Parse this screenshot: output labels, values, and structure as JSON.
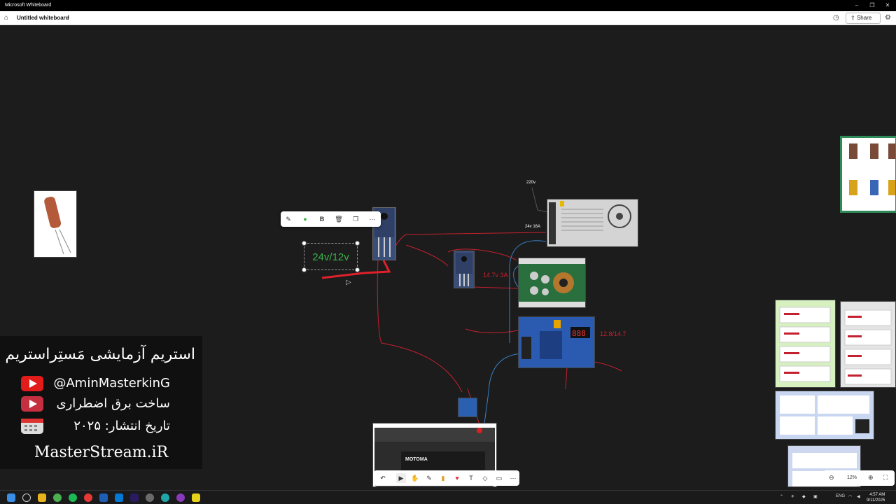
{
  "window": {
    "title": "Microsoft Whiteboard"
  },
  "appbar": {
    "board_name": "Untitled whiteboard",
    "share_label": "Share"
  },
  "canvas_labels": {
    "selected_text": "24v/12v",
    "label_220": "220v",
    "label_24v16a": "24v 16A",
    "label_147": "14.7v 3A",
    "label_128": "12.8/14.7",
    "battery_brand": "MOTOMA"
  },
  "overlay": {
    "headline": "استریم آزمایشی مَستِراستریم",
    "youtube": "@AminMasterkinG",
    "topic": "ساخت برق اضطراری",
    "date": "تاریخ انتشار: ۲۰۲۵",
    "site": "MasterStream.iR"
  },
  "zoom": {
    "level": "12%"
  },
  "taskbar": {
    "lang": "ENG",
    "time": "4:57 AM",
    "date": "9/11/2025"
  },
  "colors": {
    "accent_red": "#c4202f",
    "accent_green": "#3cb24a",
    "wire_blue": "#3a7fc0"
  }
}
